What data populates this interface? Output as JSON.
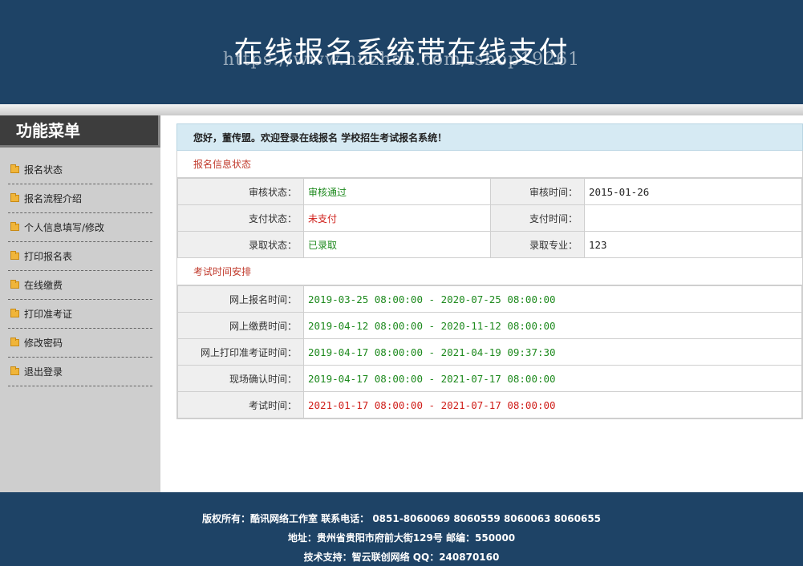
{
  "header": {
    "title": "在线报名系统带在线支付",
    "watermark": "https://www.huzhan.com/ishop19261"
  },
  "sidebar": {
    "title": "功能菜单",
    "items": [
      {
        "label": "报名状态"
      },
      {
        "label": "报名流程介绍"
      },
      {
        "label": "个人信息填写/修改"
      },
      {
        "label": "打印报名表"
      },
      {
        "label": "在线缴费"
      },
      {
        "label": "打印准考证"
      },
      {
        "label": "修改密码"
      },
      {
        "label": "退出登录"
      }
    ]
  },
  "welcome": "您好，董传盟。欢迎登录在线报名 学校招生考试报名系统！",
  "status_section": {
    "title": "报名信息状态",
    "rows": [
      {
        "l1": "审核状态：",
        "v1": "审核通过",
        "l2": "审核时间：",
        "v2": "2015-01-26"
      },
      {
        "l1": "支付状态：",
        "v1": "未支付",
        "l2": "支付时间：",
        "v2": ""
      },
      {
        "l1": "录取状态：",
        "v1": "已录取",
        "l2": "录取专业：",
        "v2": "123"
      }
    ]
  },
  "schedule_section": {
    "title": "考试时间安排",
    "rows": [
      {
        "label": "网上报名时间：",
        "value": "2019-03-25 08:00:00 - 2020-07-25 08:00:00"
      },
      {
        "label": "网上缴费时间：",
        "value": "2019-04-12 08:00:00 - 2020-11-12 08:00:00"
      },
      {
        "label": "网上打印准考证时间：",
        "value": "2019-04-17 08:00:00 - 2021-04-19 09:37:30"
      },
      {
        "label": "现场确认时间：",
        "value": "2019-04-17 08:00:00 - 2021-07-17 08:00:00"
      },
      {
        "label": "考试时间：",
        "value": "2021-01-17 08:00:00 - 2021-07-17 08:00:00"
      }
    ]
  },
  "footer": {
    "line1": "版权所有：酷讯网络工作室 联系电话： 0851-8060069 8060559 8060063 8060655",
    "line2": "地址：贵州省贵阳市府前大街129号 邮编：550000",
    "line3": "技术支持：智云联创网络 QQ：240870160"
  },
  "colors": {
    "header_bg": "#1e4366",
    "status_ok": "#1e8a1e",
    "status_alert": "#d0201b"
  }
}
